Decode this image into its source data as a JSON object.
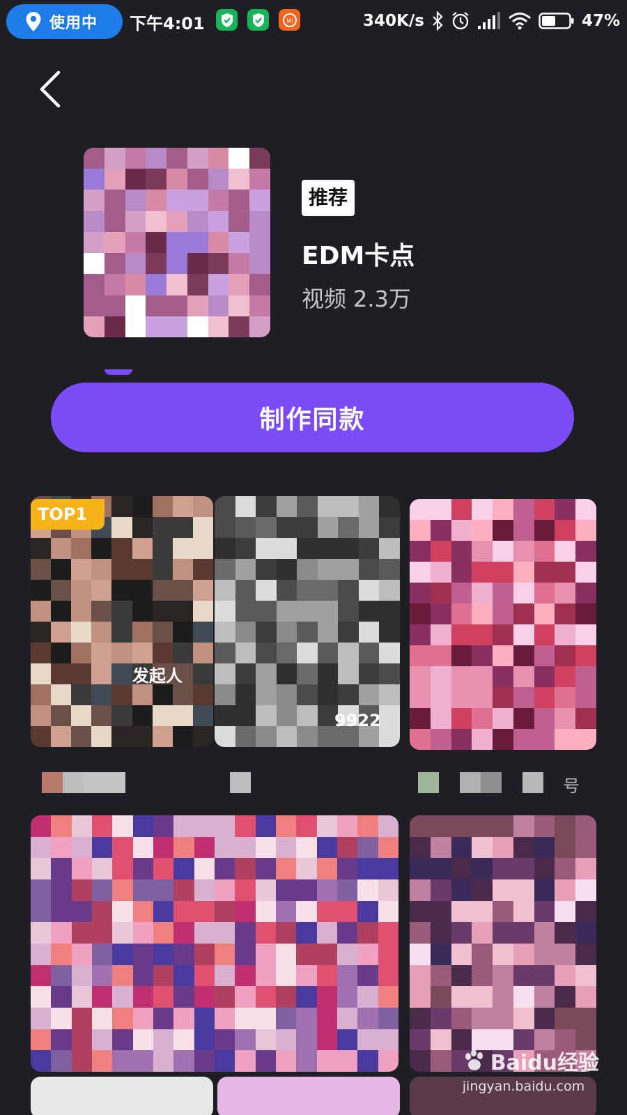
{
  "status_bar": {
    "location_label": "使用中",
    "time": "下午4:01",
    "net_speed": "340K/s",
    "battery": "47%"
  },
  "template": {
    "tag": "推荐",
    "title": "EDM卡点",
    "count_label": "视频",
    "count_value": "2.3万"
  },
  "actions": {
    "make_same": "制作同款"
  },
  "feed": {
    "top_badge": "TOP1",
    "card1_caption": "发起人",
    "card2_caption": "9922",
    "card3_caption": "号"
  },
  "watermark": {
    "brand": "Baidu经验",
    "url": "jingyan.baidu.com"
  },
  "colors": {
    "background": "#1f1e24",
    "accent": "#7b4cf6",
    "location_pill": "#1e7ce8",
    "top_badge": "#f7b31c"
  }
}
